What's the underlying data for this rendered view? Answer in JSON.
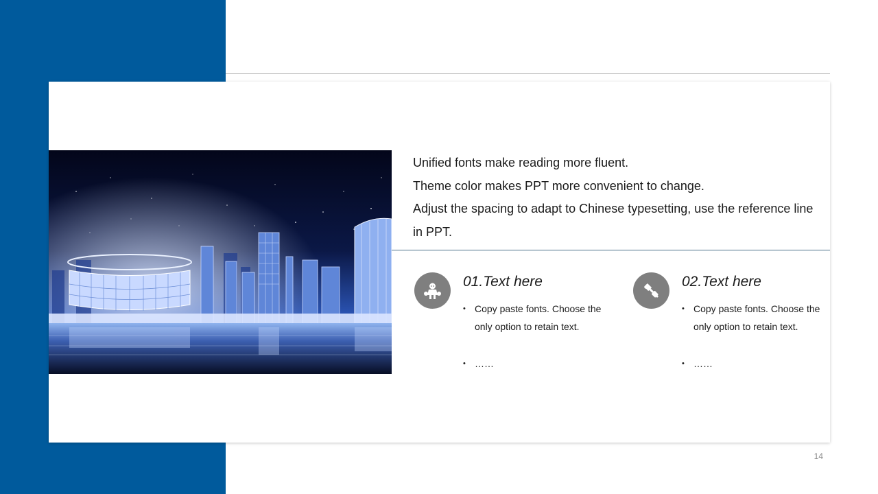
{
  "intro": {
    "line1": "Unified fonts make reading more fluent.",
    "line2": "Theme color makes PPT more convenient to change.",
    "line3": "Adjust the spacing to adapt to Chinese typesetting, use the reference line in PPT."
  },
  "features": [
    {
      "title": "01.Text here",
      "icon": "cheerleader-icon",
      "bullets": [
        "Copy paste fonts. Choose the only option to retain text.",
        "……"
      ]
    },
    {
      "title": "02.Text here",
      "icon": "tools-icon",
      "bullets": [
        "Copy paste fonts. Choose the only option to retain text.",
        "……"
      ]
    }
  ],
  "page_number": "14",
  "colors": {
    "theme_blue": "#005a9c",
    "icon_gray": "#7f7f7f",
    "divider": "#4a6f8a"
  }
}
